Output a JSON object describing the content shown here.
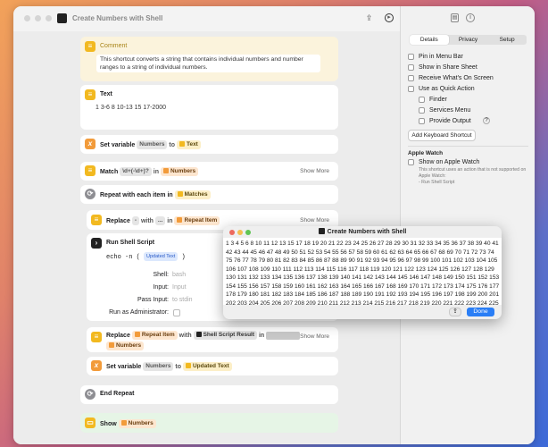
{
  "window": {
    "title": "Create Numbers with Shell"
  },
  "actions": {
    "comment": {
      "title": "Comment",
      "text": "This shortcut converts a string that contains individual numbers and number ranges to a string of individual numbers."
    },
    "text": {
      "title": "Text",
      "value": "1 3-6 8 10-13 15 17-2000"
    },
    "set_variable_1": {
      "title": "Set variable",
      "var": "Numbers",
      "to": "to",
      "value": "Text"
    },
    "match": {
      "title": "Match",
      "pattern": "\\d+(-\\d+)?",
      "in": "in",
      "var": "Numbers",
      "more": "Show More"
    },
    "repeat": {
      "title": "Repeat with each item in",
      "var": "Matches"
    },
    "replace_1": {
      "title": "Replace",
      "find": "-",
      "with": "with",
      "repl": "...",
      "in": "in",
      "var": "Repeat Item",
      "more": "Show More"
    },
    "shell": {
      "title": "Run Shell Script",
      "code": "echo -n (",
      "code_var": "Updated Text",
      "code_end": ")",
      "shell_label": "Shell:",
      "shell_val": "bash",
      "input_label": "Input:",
      "input_val": "Input",
      "pass_label": "Pass Input:",
      "pass_val": "to stdin",
      "admin_label": "Run as Administrator:"
    },
    "replace_2": {
      "title": "Replace",
      "var1": "Repeat Item",
      "with": "with",
      "var2": "Shell Script Result",
      "in": "in",
      "more": "Show More",
      "var3": "Numbers"
    },
    "set_variable_2": {
      "title": "Set variable",
      "var": "Numbers",
      "to": "to",
      "value": "Updated Text"
    },
    "end_repeat": {
      "title": "End Repeat"
    },
    "show": {
      "title": "Show",
      "var": "Numbers"
    }
  },
  "sidebar": {
    "tabs": [
      "Details",
      "Privacy",
      "Setup"
    ],
    "options": {
      "menu_bar": "Pin in Menu Bar",
      "share_sheet": "Show in Share Sheet",
      "receive_screen": "Receive What's On Screen",
      "quick_action": "Use as Quick Action",
      "finder": "Finder",
      "services": "Services Menu",
      "provide_output": "Provide Output"
    },
    "keyboard_button": "Add Keyboard Shortcut",
    "watch_header": "Apple Watch",
    "watch_option": "Show on Apple Watch",
    "watch_note": "This shortcut uses an action that is not supported on Apple Watch:",
    "watch_item": "- Run Shell Script"
  },
  "dialog": {
    "title": "Create Numbers with Shell",
    "output": "1 3 4 5 6 8 10 11 12 13 15 17 18 19 20 21 22 23 24 25 26 27 28 29 30 31 32 33 34 35 36 37 38 39 40 41 42 43 44 45 46 47 48 49 50 51 52 53 54 55 56 57 58 59 60 61 62 63 64 65 66 67 68 69 70 71 72 73 74 75 76 77 78 79 80 81 82 83 84 85 86 87 88 89 90 91 92 93 94 95 96 97 98 99 100 101 102 103 104 105 106 107 108 109 110 111 112 113 114 115 116 117 118 119 120 121 122 123 124 125 126 127 128 129 130 131 132 133 134 135 136 137 138 139 140 141 142 143 144 145 146 147 148 149 150 151 152 153 154 155 156 157 158 159 160 161 162 163 164 165 166 167 168 169 170 171 172 173 174 175 176 177 178 179 180 181 182 183 184 185 186 187 188 189 190 191 192 193 194 195 196 197 198 199 200 201 202 203 204 205 206 207 208 209 210 211 212 213 214 215 216 217 218 219 220 221 222 223 224 225 226 227 228 229 230 231 232 233 234 235 236 237 238 239 240 241 242 243 244 245 246 247 248 249 250 251 252...",
    "done": "Done"
  },
  "icons": {
    "share": "share-icon",
    "run": "run-icon",
    "info": "info-icon",
    "library": "library-icon"
  }
}
